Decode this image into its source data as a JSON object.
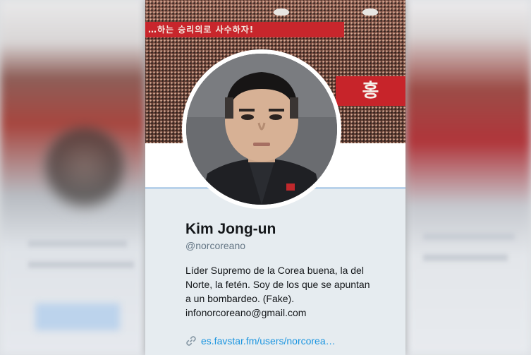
{
  "banner": {
    "slogan": "…하는 승리의로 사수하자!",
    "sign": "홍"
  },
  "profile": {
    "name": "Kim Jong-un",
    "handle": "@norcoreano",
    "bio_lines": [
      "Líder Supremo de la Corea buena, la del",
      "Norte, la fetén. Soy de los que se apuntan",
      "a un bombardeo. (Fake).",
      "infonorcoreano@gmail.com"
    ],
    "website": "es.favstar.fm/users/norcorea…"
  },
  "icons": {
    "link": "link-icon"
  },
  "colors": {
    "link": "#1b95e0",
    "name": "#14171a",
    "handle": "#657786",
    "card_bg": "#e6ecf0"
  }
}
